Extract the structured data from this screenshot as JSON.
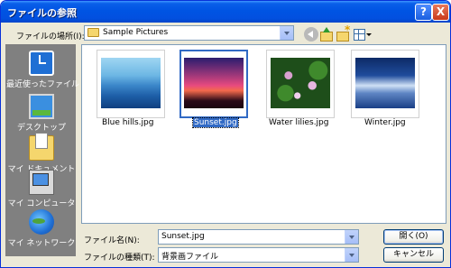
{
  "window": {
    "title": "ファイルの参照",
    "help_label": "?",
    "close_label": "X"
  },
  "toolbar": {
    "look_in_label": "ファイルの場所(I):",
    "look_in_value": "Sample Pictures",
    "icons": [
      "back-icon",
      "up-folder-icon",
      "new-folder-icon",
      "view-menu-icon"
    ]
  },
  "places": [
    {
      "label": "最近使ったファイル",
      "icon": "recent-icon"
    },
    {
      "label": "デスクトップ",
      "icon": "desktop-icon"
    },
    {
      "label": "マイ ドキュメント",
      "icon": "my-documents-icon"
    },
    {
      "label": "マイ コンピュータ",
      "icon": "my-computer-icon"
    },
    {
      "label": "マイ ネットワーク",
      "icon": "my-network-icon"
    }
  ],
  "files": [
    {
      "name": "Blue hills.jpg",
      "selected": false
    },
    {
      "name": "Sunset.jpg",
      "selected": true
    },
    {
      "name": "Water lilies.jpg",
      "selected": false
    },
    {
      "name": "Winter.jpg",
      "selected": false
    }
  ],
  "form": {
    "filename_label": "ファイル名(N):",
    "filename_value": "Sunset.jpg",
    "filetype_label": "ファイルの種類(T):",
    "filetype_value": "背景画ファイル"
  },
  "buttons": {
    "open_label": "開く(O)",
    "cancel_label": "キャンセル"
  }
}
